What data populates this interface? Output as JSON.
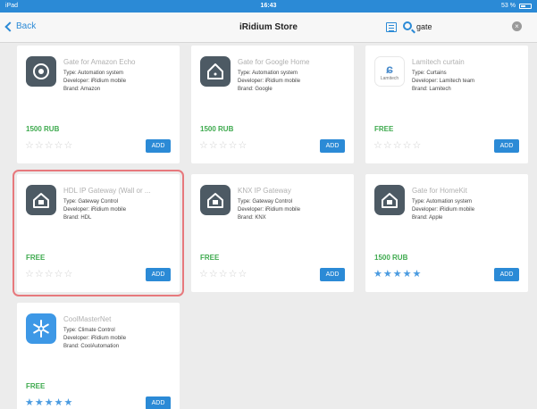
{
  "status_bar": {
    "carrier": "iPad",
    "time": "16:43",
    "battery": "53 %",
    "battery_level": 0.53
  },
  "nav": {
    "back_label": "Back",
    "title": "iRidium Store",
    "search_value": "gate"
  },
  "apps": [
    {
      "name": "Gate for Amazon Echo",
      "type": "Type: Automation system",
      "developer": "Developer: iRidium mobile",
      "brand": "Brand: Amazon",
      "price": "1500 RUB",
      "stars": "☆☆☆☆☆",
      "add_label": "ADD",
      "icon": "amazon-echo-icon"
    },
    {
      "name": "Gate for Google Home",
      "type": "Type: Automation system",
      "developer": "Developer: iRidium mobile",
      "brand": "Brand: Google",
      "price": "1500 RUB",
      "stars": "☆☆☆☆☆",
      "add_label": "ADD",
      "icon": "google-home-icon"
    },
    {
      "name": "Lamitech curtain",
      "type": "Type: Curtains",
      "developer": "Developer: Lamitech team",
      "brand": "Brand: Lamitech",
      "price": "FREE",
      "stars": "☆☆☆☆☆",
      "add_label": "ADD",
      "icon": "lamitech-logo-icon",
      "logo_text": "Lamitech"
    },
    {
      "name": "HDL IP Gateway (Wall or ...",
      "type": "Type: Gateway Control",
      "developer": "Developer: iRidium mobile",
      "brand": "Brand: HDL",
      "price": "FREE",
      "stars": "☆☆☆☆☆",
      "add_label": "ADD",
      "icon": "gateway-house-icon"
    },
    {
      "name": "KNX IP Gateway",
      "type": "Type: Gateway Control",
      "developer": "Developer: iRidium mobile",
      "brand": "Brand: KNX",
      "price": "FREE",
      "stars": "☆☆☆☆☆",
      "add_label": "ADD",
      "icon": "gateway-house-icon"
    },
    {
      "name": "Gate for HomeKit",
      "type": "Type: Automation system",
      "developer": "Developer: iRidium mobile",
      "brand": "Brand: Apple",
      "price": "1500 RUB",
      "stars": "★★★★★",
      "add_label": "ADD",
      "icon": "gateway-house-icon"
    },
    {
      "name": "CoolMasterNet",
      "type": "Type: Climate Control",
      "developer": "Developer: iRidium mobile",
      "brand": "Brand: CoolAutomation",
      "price": "FREE",
      "stars": "★★★★★",
      "add_label": "ADD",
      "icon": "snowflake-icon"
    }
  ],
  "selected_index": 3,
  "colors": {
    "accent": "#2b8ad6",
    "price_green": "#3eaa4e",
    "selection_border": "#e7797d",
    "icon_dark": "#4d5a64",
    "icon_blue": "#3d98e6"
  }
}
